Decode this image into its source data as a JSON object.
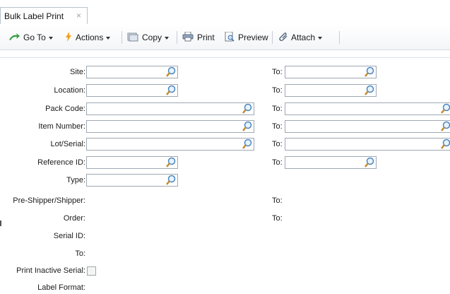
{
  "tab": {
    "title": "Bulk Label Print",
    "close_glyph": "×"
  },
  "toolbar": {
    "goto_label": "Go To",
    "actions_label": "Actions",
    "copy_label": "Copy",
    "print_label": "Print",
    "preview_label": "Preview",
    "attach_label": "Attach",
    "icons": [
      "goto-arrow-icon",
      "actions-bolt-icon",
      "copy-icon",
      "print-icon",
      "preview-icon",
      "attach-paperclip-icon"
    ]
  },
  "form": {
    "site_label": "Site:",
    "location_label": "Location:",
    "pack_code_label": "Pack Code:",
    "item_number_label": "Item Number:",
    "lot_serial_label": "Lot/Serial:",
    "reference_id_label": "Reference ID:",
    "type_label": "Type:",
    "pre_shipper_label": "Pre-Shipper/Shipper:",
    "order_label": "Order:",
    "serial_id_label": "Serial ID:",
    "serial_to_label": "To:",
    "print_inactive_label": "Print Inactive Serial:",
    "label_format_label": "Label Format:",
    "to_label": "To:",
    "values": {
      "site_from": "",
      "site_to": "",
      "location_from": "",
      "location_to": "",
      "pack_code_from": "",
      "pack_code_to": "",
      "item_number_from": "",
      "item_number_to": "",
      "lot_serial_from": "",
      "lot_serial_to": "",
      "reference_id_from": "",
      "reference_id_to": "",
      "type": ""
    },
    "print_inactive_checked": false
  }
}
